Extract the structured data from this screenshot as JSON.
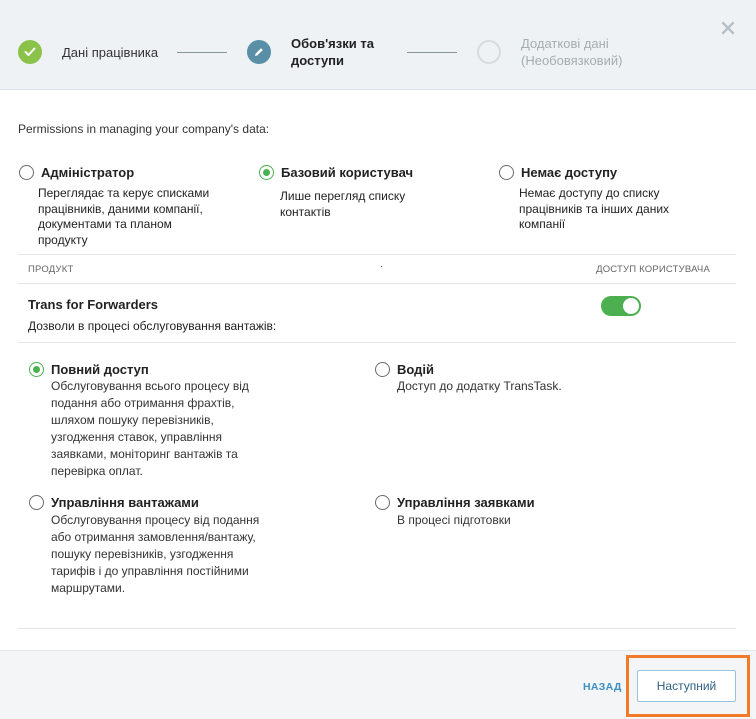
{
  "stepper": {
    "step1_label": "Дані працівника",
    "step2_label_line1": "Обов'язки та",
    "step2_label_line2": "доступи",
    "step3_label_line1": "Додаткові дані",
    "step3_label_line2": "(Необовязковий)",
    "close_label": "×"
  },
  "intro": "Permissions in managing your company's data:",
  "roles": [
    {
      "title": "Адміністратор",
      "desc": [
        "Переглядає та керує списками",
        "працівників, даними компанії,",
        "документами та планом",
        "продукту"
      ],
      "checked": false
    },
    {
      "title": "Базовий користувач",
      "desc": [
        "Лише перегляд списку",
        "контактів"
      ],
      "checked": true
    },
    {
      "title": "Немає доступу",
      "desc": [
        "Немає доступу до списку",
        "працівників та інших даних",
        "компанії"
      ],
      "checked": false
    }
  ],
  "table_header": {
    "left": "ПРОДУКТ",
    "dot": "·",
    "right": "ДОСТУП КОРИСТУВАЧА"
  },
  "product": {
    "name": "Trans for Forwarders",
    "subtitle": "Дозволи в процесі обслуговування вантажів:",
    "enabled": true
  },
  "permissions": [
    {
      "title": "Повний доступ",
      "desc": [
        "Обслуговування всього процесу від",
        "подання або отримання фрахтів,",
        "шляхом пошуку перевізників,",
        "узгодження ставок, управління",
        "заявками, моніторинг вантажів та",
        "перевірка оплат."
      ],
      "checked": true
    },
    {
      "title": "Водій",
      "desc": [
        "Доступ до додатку TransTask."
      ],
      "checked": false
    },
    {
      "title": "Управління вантажами",
      "desc": [
        "Обслуговування процесу від подання",
        "або отримання замовлення/вантажу,",
        "пошуку перевізників, узгодження",
        "тарифів і до управління постійними",
        "маршрутами."
      ],
      "checked": false
    },
    {
      "title": "Управління заявками",
      "desc": [
        "В процесі підготовки"
      ],
      "checked": false
    }
  ],
  "footer": {
    "back_label": "НАЗАД",
    "next_label": "Наступний"
  },
  "colors": {
    "accent_green": "#4caf50",
    "step_done": "#8bc34a",
    "step_active": "#5a8fa8",
    "link_blue": "#3d8fc6",
    "highlight_orange": "#f07c2a"
  }
}
